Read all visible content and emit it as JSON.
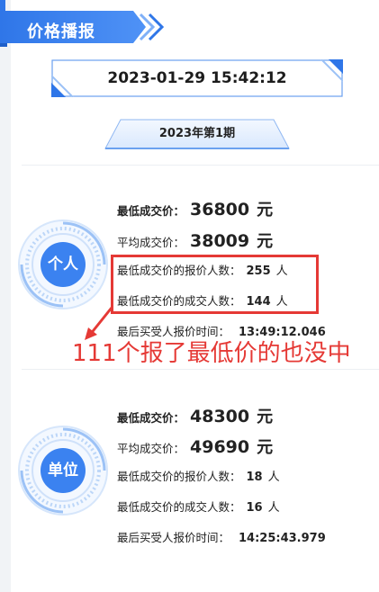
{
  "header": {
    "title": "价格播报"
  },
  "datetime": "2023-01-29 15:42:12",
  "period": "2023年第1期",
  "individual": {
    "badge": "个人",
    "min_price_label": "最低成交价：",
    "min_price": "36800",
    "avg_price_label": "平均成交价：",
    "avg_price": "38009",
    "currency": "元",
    "min_bidders_label": "最低成交价的报价人数：",
    "min_bidders": "255",
    "min_deals_label": "最低成交价的成交人数：",
    "min_deals": "144",
    "people_unit": "人",
    "last_bid_label": "最后买受人报价时间：",
    "last_bid_time": "13:49:12.046"
  },
  "company": {
    "badge": "单位",
    "min_price_label": "最低成交价：",
    "min_price": "48300",
    "avg_price_label": "平均成交价：",
    "avg_price": "49690",
    "currency": "元",
    "min_bidders_label": "最低成交价的报价人数：",
    "min_bidders": "18",
    "min_deals_label": "最低成交价的成交人数：",
    "min_deals": "16",
    "people_unit": "人",
    "last_bid_label": "最后买受人报价时间：",
    "last_bid_time": "14:25:43.979"
  },
  "annotation": {
    "text": "111个报了最低价的也没中",
    "color": "#e53935"
  },
  "colors": {
    "accent": "#2f76e8",
    "badge_blue": "#3b82f0",
    "highlight": "#e53935"
  }
}
